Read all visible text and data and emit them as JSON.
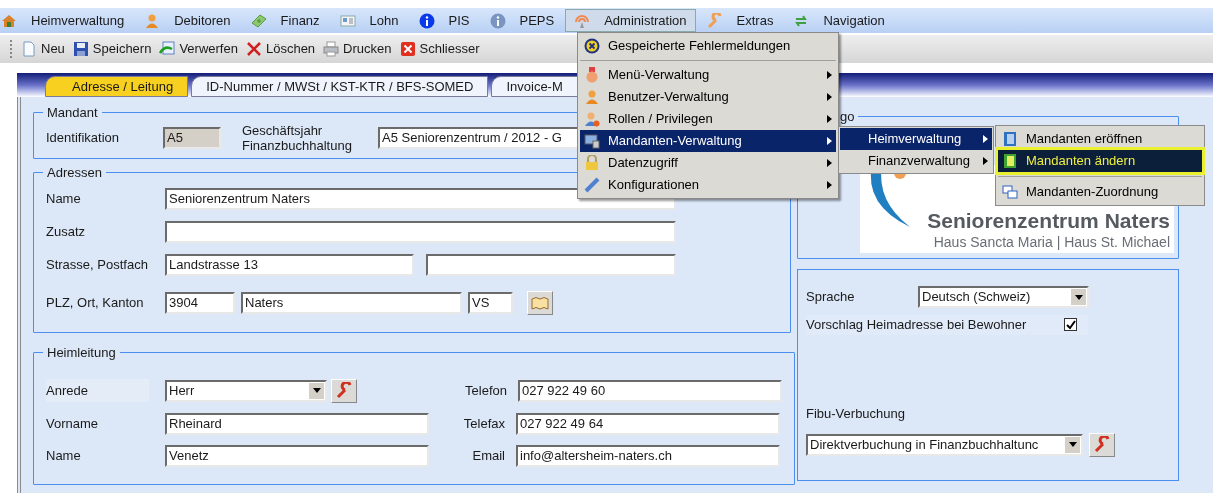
{
  "menu_bar": [
    {
      "label": "Heimverwaltung",
      "selected": false
    },
    {
      "label": "Debitoren",
      "selected": false
    },
    {
      "label": "Finanz",
      "selected": false
    },
    {
      "label": "Lohn",
      "selected": false
    },
    {
      "label": "PIS",
      "selected": false
    },
    {
      "label": "PEPS",
      "selected": false
    },
    {
      "label": "Administration",
      "selected": true
    },
    {
      "label": "Extras",
      "selected": false
    },
    {
      "label": "Navigation",
      "selected": false
    }
  ],
  "toolbar": [
    "Neu",
    "Speichern",
    "Verwerfen",
    "Löschen",
    "Drucken",
    "Schliesser"
  ],
  "tabs": [
    {
      "label": "Adresse / Leitung",
      "selected": true
    },
    {
      "label": "ID-Nummer / MWSt / KST-KTR / BFS-SOMED",
      "selected": false
    },
    {
      "label": "Invoice-M",
      "selected": false
    }
  ],
  "mandant": {
    "title": "Mandant",
    "identifikation_label": "Identifikation",
    "identifikation": "A5",
    "geschaeftsjahr_label": "Geschäftsjahr\nFinanzbuchhaltung",
    "geschaeftsjahr": "A5 Seniorenzentrum / 2012 - G"
  },
  "adressen": {
    "title": "Adressen",
    "name_label": "Name",
    "name": "Seniorenzentrum Naters",
    "zusatz_label": "Zusatz",
    "strasse_label": "Strasse, Postfach",
    "strasse": "Landstrasse 13",
    "plz_label": "PLZ, Ort, Kanton",
    "plz": "3904",
    "ort": "Naters",
    "kanton": "VS"
  },
  "heimleitung": {
    "title": "Heimleitung",
    "anrede_label": "Anrede",
    "anrede": "Herr",
    "vorname_label": "Vorname",
    "vorname": "Rheinard",
    "name_label": "Name",
    "name": "Venetz",
    "telefon_label": "Telefon",
    "telefon": "027 922 49 60",
    "telefax_label": "Telefax",
    "telefax": "027 922 49 64",
    "email_label": "Email",
    "email": "info@altersheim-naters.ch"
  },
  "logo": {
    "title": "go",
    "name": "Seniorenzentrum Naters",
    "subtitle": "Haus Sancta Maria | Haus St. Michael"
  },
  "settings": {
    "sprache_label": "Sprache",
    "sprache": "Deutsch (Schweiz)",
    "vorschlag_label": "Vorschlag Heimadresse bei Bewohner",
    "vorschlag_checked": true,
    "fibu_label": "Fibu-Verbuchung",
    "fibu": "Direktverbuchung in Finanzbuchhaltunc"
  },
  "admin_menu": {
    "top_items": [
      {
        "label": "Gespeicherte Fehlermeldungen"
      }
    ],
    "items": [
      {
        "label": "Menü-Verwaltung",
        "selected": false
      },
      {
        "label": "Benutzer-Verwaltung",
        "selected": false
      },
      {
        "label": "Rollen / Privilegen",
        "selected": false
      },
      {
        "label": "Mandanten-Verwaltung",
        "selected": true
      },
      {
        "label": "Datenzugriff",
        "selected": false
      },
      {
        "label": "Konfigurationen",
        "selected": false
      }
    ]
  },
  "mandanten_submenu": [
    {
      "label": "Heimverwaltung",
      "selected": true
    },
    {
      "label": "Finanzverwaltung",
      "selected": false
    }
  ],
  "heim_submenu": {
    "items": [
      {
        "label": "Mandanten eröffnen",
        "selected": false
      },
      {
        "label": "Mandanten ändern",
        "selected": true
      }
    ],
    "after_separator": [
      {
        "label": "Mandanten-Zuordnung",
        "selected": false
      }
    ]
  }
}
